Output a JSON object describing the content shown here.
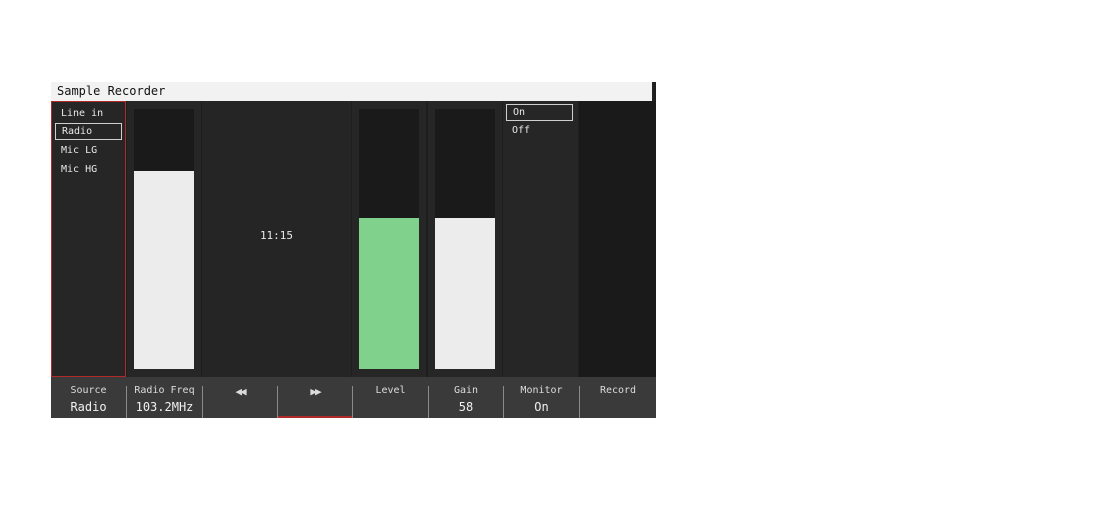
{
  "window": {
    "title": "Sample Recorder"
  },
  "source_list": {
    "items": [
      "Line in",
      "Radio",
      "Mic LG",
      "Mic HG"
    ],
    "selected_index": 1
  },
  "meters": {
    "radio_freq_level": 0.76,
    "level": 0.58,
    "gain": 0.58,
    "level_color": "#7fd18c",
    "neutral_color": "#ececec"
  },
  "time_display": "11:15",
  "monitor_list": {
    "items": [
      "On",
      "Off"
    ],
    "selected_index": 0
  },
  "toolbar": {
    "source": {
      "label": "Source",
      "value": "Radio"
    },
    "radio_freq": {
      "label": "Radio Freq",
      "value": "103.2MHz"
    },
    "rewind": {
      "glyph": "◀◀"
    },
    "forward": {
      "glyph": "▶▶"
    },
    "level": {
      "label": "Level",
      "value": ""
    },
    "gain": {
      "label": "Gain",
      "value": "58"
    },
    "monitor": {
      "label": "Monitor",
      "value": "On"
    },
    "record": {
      "label": "Record",
      "value": ""
    }
  }
}
